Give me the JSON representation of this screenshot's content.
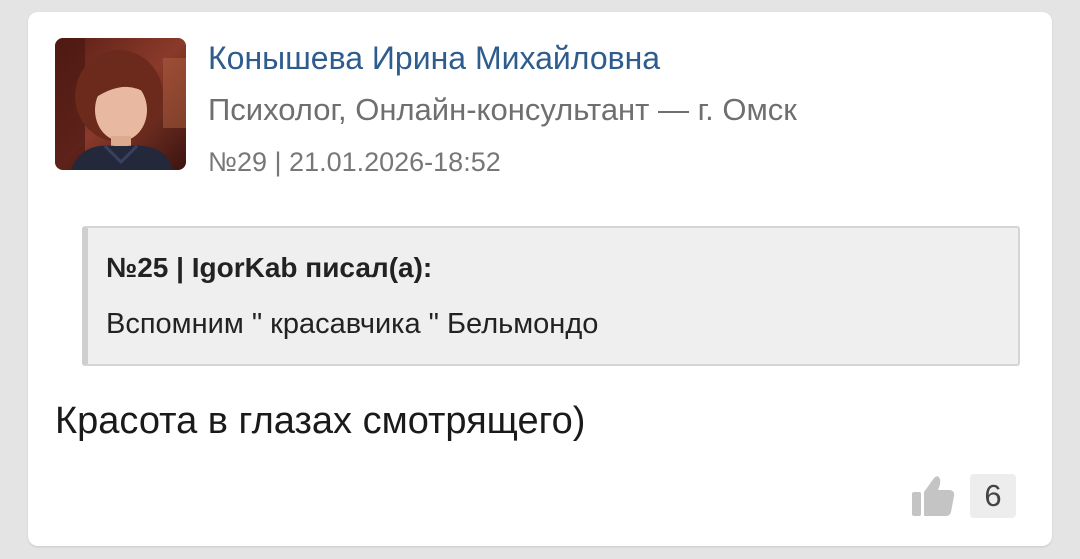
{
  "post": {
    "author_name": "Конышева Ирина Михайловна",
    "author_role": "Психолог, Онлайн-консультант — г. Омск",
    "number": "№29",
    "separator": "|",
    "datetime": "21.01.2026-18:52",
    "quote": {
      "header": "№25 | IgorKab писал(а):",
      "text": "Вспомним \" красавчика \" Бельмондо"
    },
    "text": "Красота в глазах смотрящего)",
    "likes": "6"
  },
  "colors": {
    "author_link": "#2d5c8d",
    "like_icon": "#c4c4c4",
    "background": "#e4e4e4"
  },
  "icons": {
    "avatar": "user-photo",
    "like": "thumbs-up-icon"
  }
}
